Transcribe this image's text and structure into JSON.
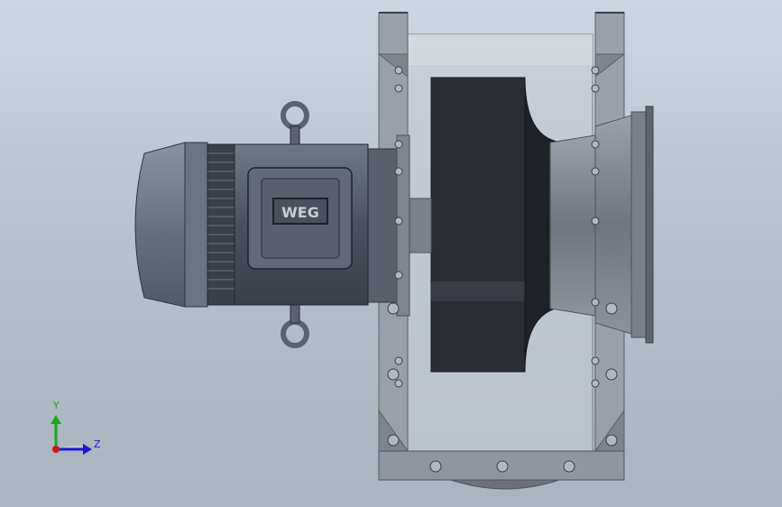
{
  "viewport": {
    "background_top": "#cdd6e0",
    "background_bottom": "#a9b4bf"
  },
  "model": {
    "motor_logo_text": "WEG",
    "motor_color": "#5f6673",
    "housing_color": "#8a9099",
    "impeller_color": "#2a2d33",
    "glass_color": "#c6ccd4"
  },
  "triad": {
    "y_label": "Y",
    "z_label": "Z",
    "y_color": "#1aa81a",
    "z_color": "#1a1acc",
    "origin_color": "#cc1a1a"
  }
}
